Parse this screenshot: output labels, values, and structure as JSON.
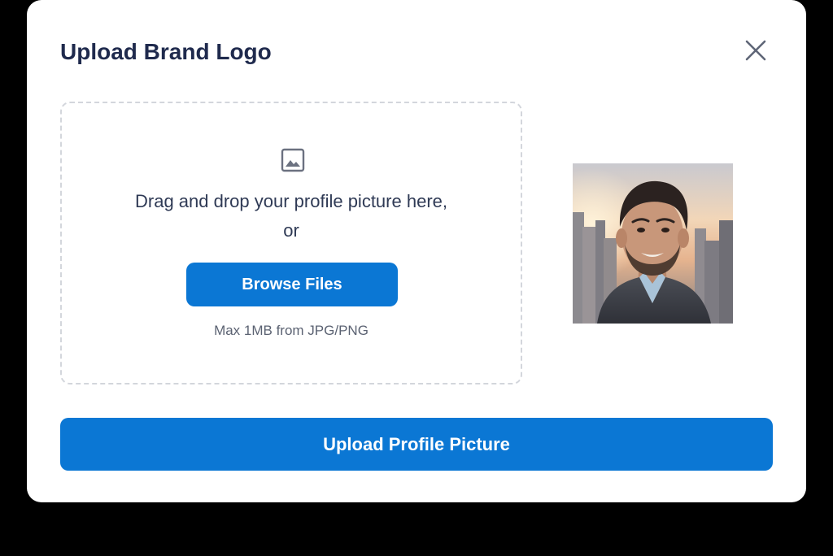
{
  "modal": {
    "title": "Upload Brand Logo",
    "close_icon": "close-icon"
  },
  "dropzone": {
    "icon": "image-icon",
    "drag_text": "Drag and drop your profile picture here,",
    "or_text": "or",
    "browse_label": "Browse Files",
    "hint": "Max 1MB from JPG/PNG"
  },
  "preview": {
    "description_icon": "profile-photo-preview"
  },
  "actions": {
    "upload_label": "Upload Profile Picture"
  },
  "colors": {
    "accent": "#0b77d4",
    "title": "#1f2a4d",
    "backdrop": "#000000",
    "border": "#d3d6dc"
  }
}
